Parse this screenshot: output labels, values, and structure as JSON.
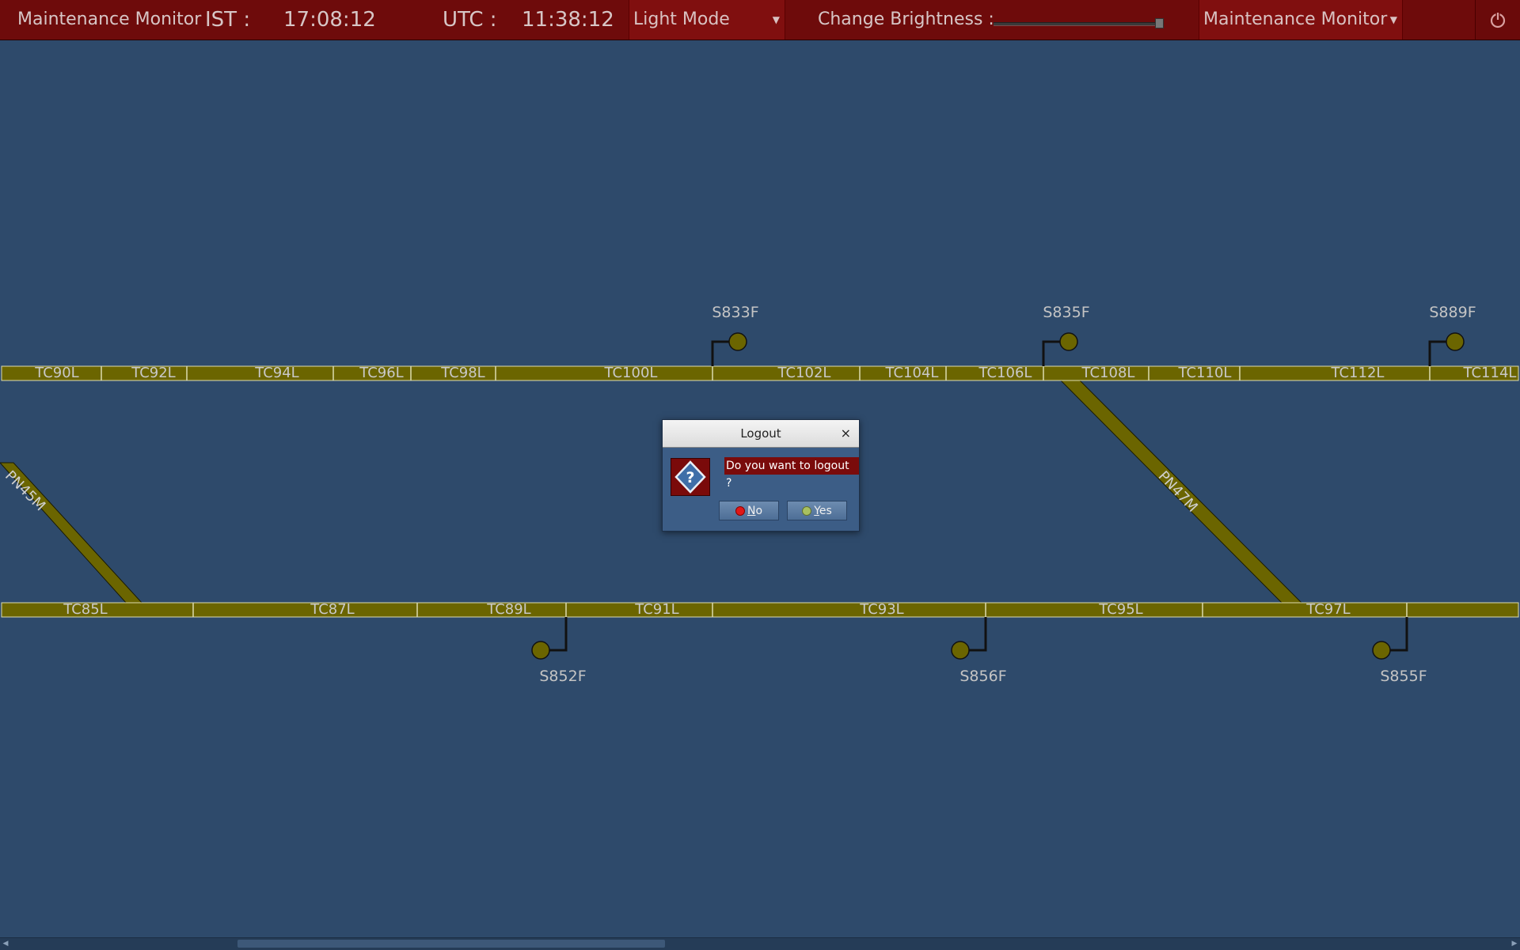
{
  "header": {
    "app_title": "Maintenance Monitor",
    "ist_label": "IST :",
    "ist_time": "17:08:12",
    "utc_label": "UTC :",
    "utc_time": "11:38:12",
    "mode_select_value": "Light Mode",
    "brightness_label": "Change Brightness :",
    "brightness_level_fraction": 1.0,
    "view_select_value": "Maintenance Monitor",
    "power_icon": "power-icon"
  },
  "tracks": {
    "upper_circuits": [
      "TC90L",
      "TC92L",
      "TC94L",
      "TC96L",
      "TC98L",
      "TC100L",
      "TC102L",
      "TC104L",
      "TC106L",
      "TC108L",
      "TC110L",
      "TC112L",
      "TC114L"
    ],
    "lower_circuits": [
      "TC85L",
      "TC87L",
      "TC89L",
      "TC91L",
      "TC93L",
      "TC95L",
      "TC97L"
    ],
    "crossovers": [
      "PN45M",
      "PN47M"
    ],
    "upper_signals": [
      "S833F",
      "S835F",
      "S889F"
    ],
    "lower_signals": [
      "S852F",
      "S856F",
      "S855F"
    ],
    "track_color": "#6b6500",
    "signal_color": "#6b6500"
  },
  "dialog": {
    "title": "Logout",
    "close_glyph": "×",
    "icon": "question-icon",
    "message": "Do you want to logout ?",
    "no_mnemonic": "N",
    "no_rest": "o",
    "yes_mnemonic": "Y",
    "yes_rest": "es"
  }
}
